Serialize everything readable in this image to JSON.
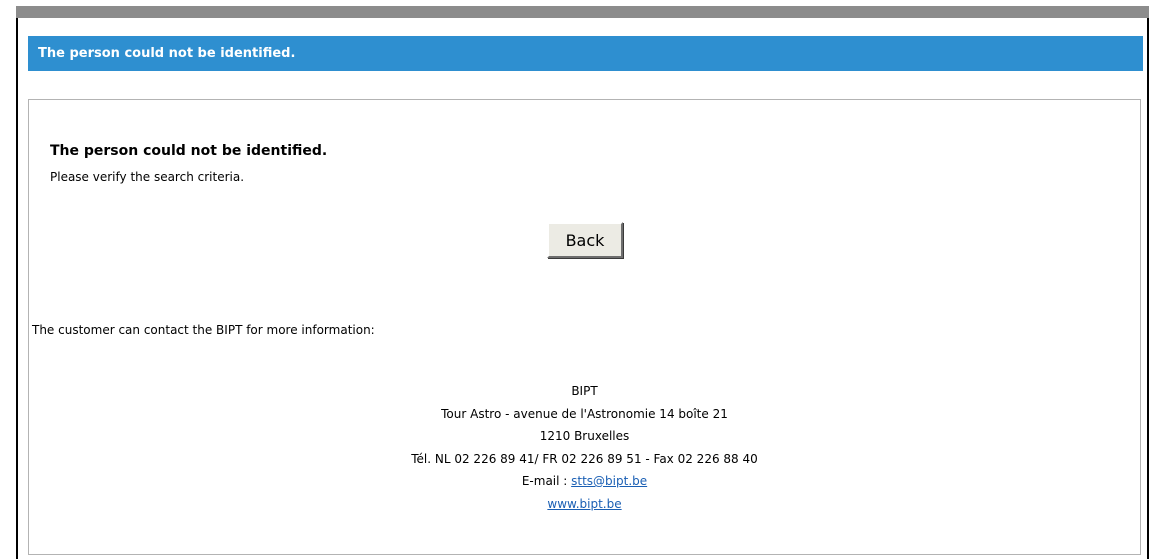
{
  "header": {
    "title": "The person could not be identified."
  },
  "message": {
    "title": "The person could not be identified.",
    "subtitle": "Please verify the search criteria."
  },
  "buttons": {
    "back_label": "Back"
  },
  "contact": {
    "intro": "The customer can contact the BIPT for more information:",
    "org": "BIPT",
    "street": "Tour Astro - avenue de l'Astronomie 14 boîte 21",
    "city": "1210 Bruxelles",
    "phone": "Tél. NL 02 226 89 41/ FR 02 226 89 51 - Fax 02 226 88 40",
    "email_prefix": "E-mail : ",
    "email": "stts@bipt.be",
    "website": "www.bipt.be"
  },
  "colors": {
    "header_bg": "#2e8fd0",
    "link": "#1a5fb4"
  }
}
